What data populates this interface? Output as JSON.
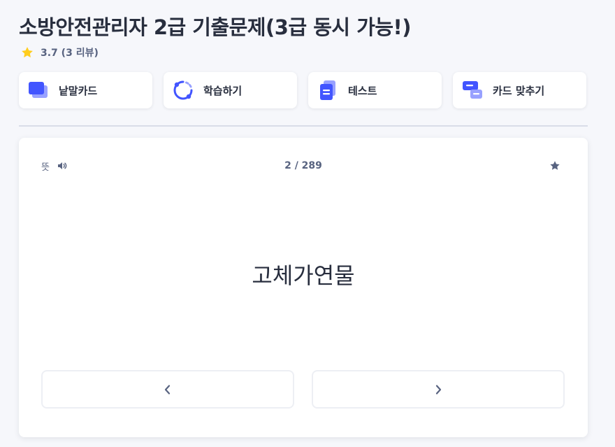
{
  "header": {
    "title": "소방안전관리자 2급 기출문제(3급 동시 가능!)",
    "rating_text": "3.7 (3 리뷰)",
    "star_color": "#ffcd1f"
  },
  "modes": [
    {
      "label": "낱말카드",
      "icon": "flashcards-icon"
    },
    {
      "label": "학습하기",
      "icon": "learn-icon"
    },
    {
      "label": "테스트",
      "icon": "test-icon"
    },
    {
      "label": "카드 맞추기",
      "icon": "match-icon"
    }
  ],
  "card": {
    "side_label": "뜻",
    "counter": "2 / 289",
    "term": "고체가연물"
  },
  "colors": {
    "accent": "#4255ff",
    "accent_light": "#98a1ff",
    "text_primary": "#282e3e",
    "text_secondary": "#586380"
  }
}
